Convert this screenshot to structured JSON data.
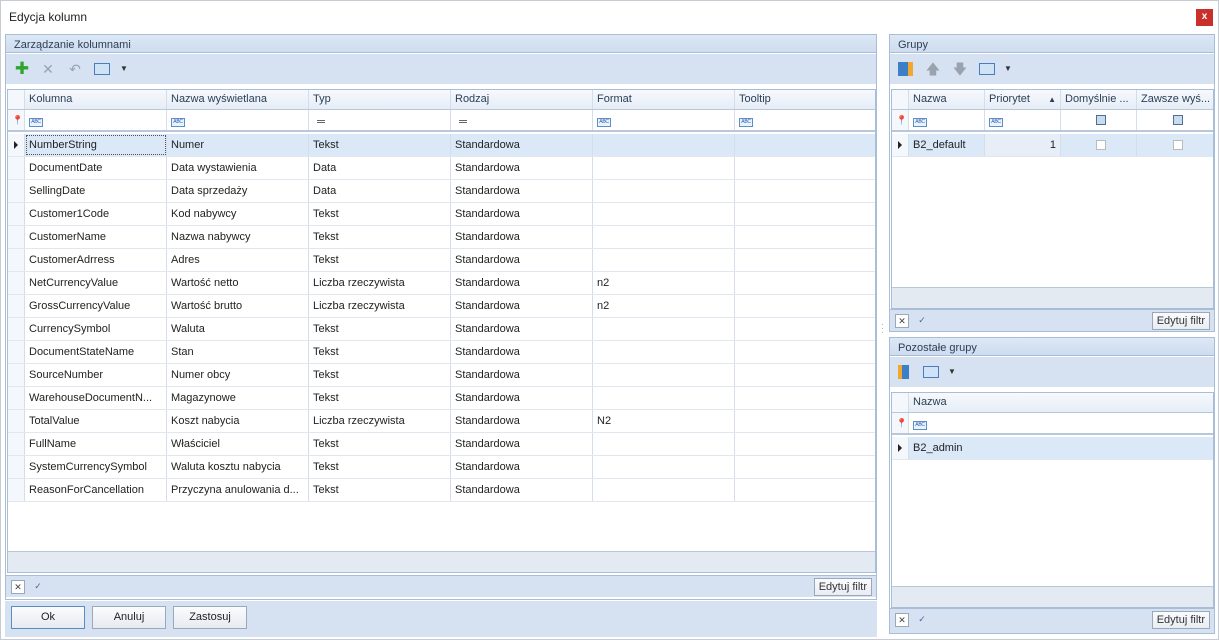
{
  "window": {
    "title": "Edycja kolumn",
    "close": "x"
  },
  "main": {
    "title": "Zarządzanie kolumnami",
    "columns": [
      "Kolumna",
      "Nazwa wyświetlana",
      "Typ",
      "Rodzaj",
      "Format",
      "Tooltip"
    ],
    "rows": [
      [
        "NumberString",
        "Numer",
        "Tekst",
        "Standardowa",
        ""
      ],
      [
        "DocumentDate",
        "Data wystawienia",
        "Data",
        "Standardowa",
        ""
      ],
      [
        "SellingDate",
        "Data sprzedaży",
        "Data",
        "Standardowa",
        ""
      ],
      [
        "Customer1Code",
        "Kod nabywcy",
        "Tekst",
        "Standardowa",
        ""
      ],
      [
        "CustomerName",
        "Nazwa nabywcy",
        "Tekst",
        "Standardowa",
        ""
      ],
      [
        "CustomerAdrress",
        "Adres",
        "Tekst",
        "Standardowa",
        ""
      ],
      [
        "NetCurrencyValue",
        "Wartość netto",
        "Liczba rzeczywista",
        "Standardowa",
        "n2"
      ],
      [
        "GrossCurrencyValue",
        "Wartość brutto",
        "Liczba rzeczywista",
        "Standardowa",
        "n2"
      ],
      [
        "CurrencySymbol",
        "Waluta",
        "Tekst",
        "Standardowa",
        ""
      ],
      [
        "DocumentStateName",
        "Stan",
        "Tekst",
        "Standardowa",
        ""
      ],
      [
        "SourceNumber",
        "Numer obcy",
        "Tekst",
        "Standardowa",
        ""
      ],
      [
        "WarehouseDocumentN...",
        "Magazynowe",
        "Tekst",
        "Standardowa",
        ""
      ],
      [
        "TotalValue",
        "Koszt nabycia",
        "Liczba rzeczywista",
        "Standardowa",
        "N2"
      ],
      [
        "FullName",
        "Właściciel",
        "Tekst",
        "Standardowa",
        ""
      ],
      [
        "SystemCurrencySymbol",
        "Waluta kosztu nabycia",
        "Tekst",
        "Standardowa",
        ""
      ],
      [
        "ReasonForCancellation",
        "Przyczyna anulowania d...",
        "Tekst",
        "Standardowa",
        ""
      ]
    ],
    "edit_filter": "Edytuj filtr",
    "abc": "ABC"
  },
  "groups": {
    "title": "Grupy",
    "columns": [
      "Nazwa",
      "Priorytet",
      "Domyślnie ...",
      "Zawsze wyś..."
    ],
    "rows": [
      {
        "name": "B2_default",
        "priority": "1"
      }
    ],
    "edit_filter": "Edytuj filtr"
  },
  "other_groups": {
    "title": "Pozostałe grupy",
    "columns": [
      "Nazwa"
    ],
    "rows": [
      "B2_admin"
    ],
    "edit_filter": "Edytuj filtr"
  },
  "buttons": {
    "ok": "Ok",
    "cancel": "Anuluj",
    "apply": "Zastosuj"
  }
}
